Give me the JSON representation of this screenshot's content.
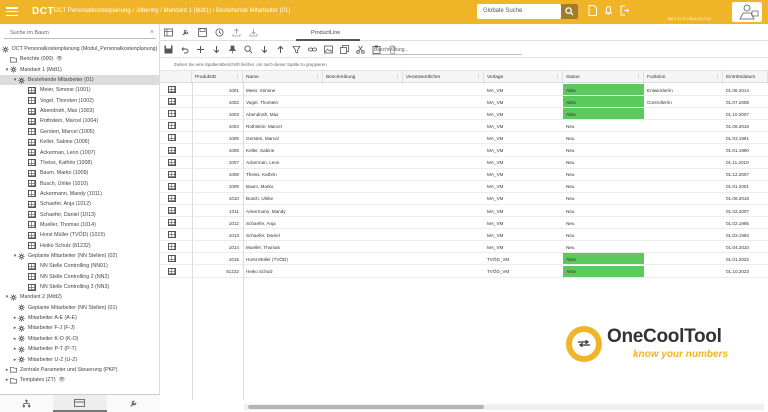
{
  "header": {
    "brand": "DCT",
    "breadcrumb": "DCT Personalkostenplanung / Jobentry / Mandant 1 (Mdt1) / Bestehende Mitarbeiter (01)",
    "search_placeholder": "Globale Suche",
    "version": "Rel 2.17.01 | 0B.0 13.17.16"
  },
  "tree": {
    "search_placeholder": "Suche im Baum",
    "root": "DCT Personalkostenplanung (Modul_Personalkostenplanung)",
    "nodes": [
      {
        "label": "Berichte (000)"
      },
      {
        "label": "Mandant 1 (Mdt1)"
      },
      {
        "label": "Bestehende Mitarbeiter (01)"
      },
      {
        "label": "Meier, Simone (1001)"
      },
      {
        "label": "Vogel, Thorsten (1002)"
      },
      {
        "label": "Abendroth, Max (1003)"
      },
      {
        "label": "Rothstein, Marcel (1004)"
      },
      {
        "label": "Gersten, Marcel (1005)"
      },
      {
        "label": "Keller, Sabine (1006)"
      },
      {
        "label": "Ackerman, Leon (1007)"
      },
      {
        "label": "Theiss, Kathrin (1008)"
      },
      {
        "label": "Baum, Marko (1009)"
      },
      {
        "label": "Busch, Ulrike (1010)"
      },
      {
        "label": "Ackermann, Mandy (1011)"
      },
      {
        "label": "Schaefer, Anja (1012)"
      },
      {
        "label": "Schaefer, Daniel (1013)"
      },
      {
        "label": "Mueller, Thomas (1014)"
      },
      {
        "label": "Horst Müller (TVÖD) (1015)"
      },
      {
        "label": "Heiko Schulz (81232)"
      },
      {
        "label": "Geplante Mitarbeiter (NN Stellen) (02)"
      },
      {
        "label": "NN Stelle Controlling (NN01)"
      },
      {
        "label": "NN Stelle Controlling 2 (NN2)"
      },
      {
        "label": "NN Stelle Controlling 3 (NN3)"
      },
      {
        "label": "Mandant 2 (Mdt2)"
      },
      {
        "label": "Geplante Mitarbeiter (NN Stellen) (01)"
      },
      {
        "label": "Mitarbeiter A-E (A-E)"
      },
      {
        "label": "Mitarbeiter F-J (F-J)"
      },
      {
        "label": "Mitarbeiter K-O (K-O)"
      },
      {
        "label": "Mitarbeiter P-T (P-T)"
      },
      {
        "label": "Mitarbeiter U-Z (U-Z)"
      },
      {
        "label": "Zentrale Parameter und Steuerung (PKP)"
      },
      {
        "label": "Templates (ZT)"
      }
    ]
  },
  "tab": {
    "label": "ProductLine"
  },
  "toolbar": {
    "description_placeholder": "Beschreibung..."
  },
  "grouping_hint": "Ziehen Sie eine Spaltenüberschrift hierher, um nach dieser Spalte zu gruppieren",
  "table": {
    "columns": [
      "ProduktID",
      "Name",
      "Beschreibung",
      "Verantwortlicher",
      "Vorlage",
      "Status",
      "Funktion",
      "Eintrittsdatum"
    ],
    "rows": [
      [
        "1001",
        "Meier, Simone",
        "",
        "",
        "MA_VM",
        "Aktiv",
        "Entwickler/in",
        "01.08.2014"
      ],
      [
        "1002",
        "Vogel, Thorsten",
        "",
        "",
        "MA_VM",
        "Aktiv",
        "Controller/in",
        "01.07.2008"
      ],
      [
        "1003",
        "Abendroth, Max",
        "",
        "",
        "MA_VM",
        "Aktiv",
        "",
        "01.10.2007"
      ],
      [
        "1004",
        "Rothstein, Marcel",
        "",
        "",
        "MA_VM",
        "Neu",
        "",
        "01.08.2018"
      ],
      [
        "1005",
        "Gersten, Marcel",
        "",
        "",
        "MA_VM",
        "Neu",
        "",
        "01.03.1991"
      ],
      [
        "1006",
        "Keller, Sabine",
        "",
        "",
        "MA_VM",
        "Neu",
        "",
        "01.01.1990"
      ],
      [
        "1007",
        "Ackerman, Leon",
        "",
        "",
        "MA_VM",
        "Neu",
        "",
        "01.11.2010"
      ],
      [
        "1008",
        "Theiss, Kathrin",
        "",
        "",
        "MA_VM",
        "Neu",
        "",
        "01.12.2007"
      ],
      [
        "1009",
        "Baum, Marko",
        "",
        "",
        "MA_VM",
        "Neu",
        "",
        "01.01.2001"
      ],
      [
        "1010",
        "Busch, Ulrike",
        "",
        "",
        "MA_VM",
        "Neu",
        "",
        "01.08.2018"
      ],
      [
        "1011",
        "Ackermann, Mandy",
        "",
        "",
        "MA_VM",
        "Neu",
        "",
        "01.02.2007"
      ],
      [
        "1012",
        "Schaefer, Anja",
        "",
        "",
        "MA_VM",
        "Neu",
        "",
        "01.02.1995"
      ],
      [
        "1013",
        "Schaefer, Daniel",
        "",
        "",
        "MA_VM",
        "Neu",
        "",
        "01.03.1993"
      ],
      [
        "1014",
        "Mueller, Thomas",
        "",
        "",
        "MA_VM",
        "Neu",
        "",
        "01.04.2010"
      ],
      [
        "1015",
        "Horst Müller (TVÖD)",
        "",
        "",
        "TVÖD_VM",
        "Aktiv",
        "",
        "01.01.2022"
      ],
      [
        "81232",
        "Heiko Schulz",
        "",
        "",
        "TVÖD_VM",
        "Aktiv",
        "",
        "01.10.2023"
      ]
    ]
  },
  "logo": {
    "name": "OneCoolTool",
    "tagline": "know your numbers"
  },
  "colors": {
    "accent": "#f0b429",
    "active_status": "#5cc95c"
  }
}
